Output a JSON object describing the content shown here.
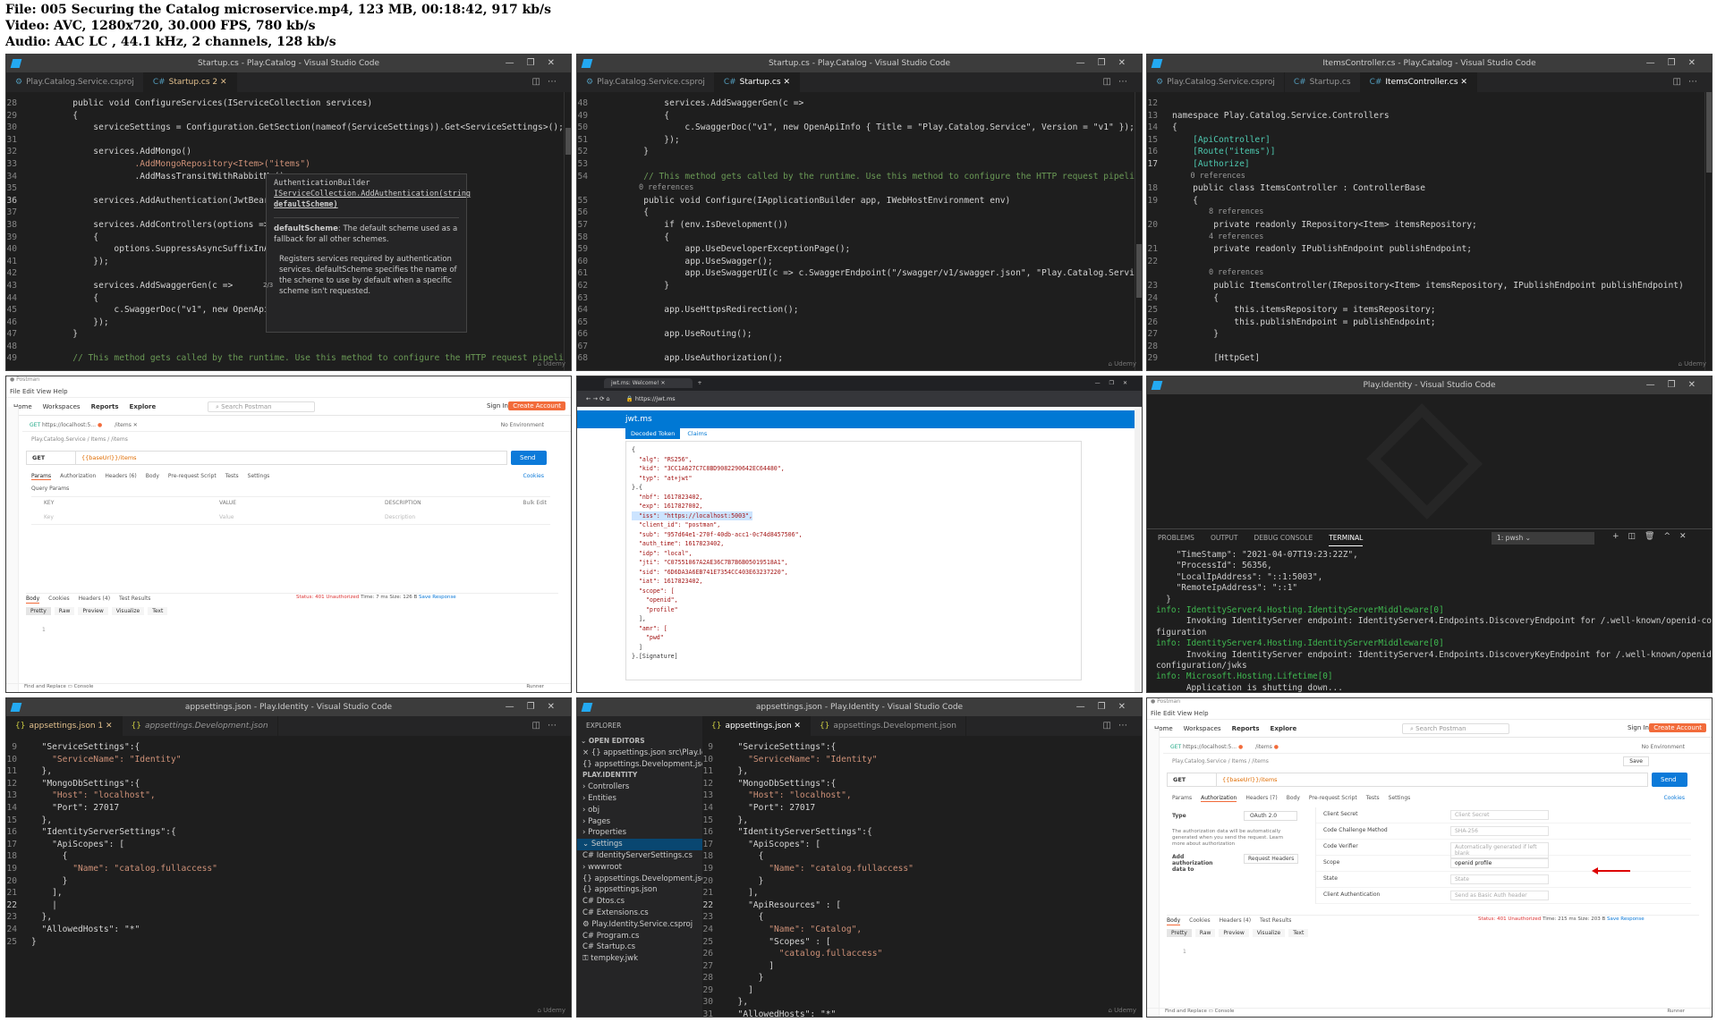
{
  "header": {
    "line1": "File: 005 Securing the Catalog microservice.mp4, 123 MB, 00:18:42, 917 kb/s",
    "line2": "Video: AVC, 1280x720, 30.000 FPS, 780 kb/s",
    "line3": "Audio: AAC LC , 44.1 kHz, 2 channels, 128 kb/s"
  },
  "t1": {
    "title": "Startup.cs - Play.Catalog - Visual Studio Code",
    "tab1": "Play.Catalog.Service.csproj",
    "tab2": "Startup.cs 2",
    "lines": [
      {
        "n": "28",
        "t": "        public void ConfigureServices(IServiceCollection services)"
      },
      {
        "n": "29",
        "t": "        {"
      },
      {
        "n": "30",
        "t": "            serviceSettings = Configuration.GetSection(nameof(ServiceSettings)).Get<ServiceSettings>();"
      },
      {
        "n": "31",
        "t": ""
      },
      {
        "n": "32",
        "t": "            services.AddMongo()"
      },
      {
        "n": "33",
        "t": "                    .AddMongoRepository<Item>(\"items\")"
      },
      {
        "n": "34",
        "t": "                    .AddMassTransitWithRabbitMq();"
      },
      {
        "n": "35",
        "t": ""
      },
      {
        "n": "36",
        "t": "            services.AddAuthentication(JwtBearerDefaults);"
      },
      {
        "n": "37",
        "t": ""
      },
      {
        "n": "38",
        "t": "            services.AddControllers(options =>"
      },
      {
        "n": "39",
        "t": "            {"
      },
      {
        "n": "40",
        "t": "                options.SuppressAsyncSuffixInActionNa"
      },
      {
        "n": "41",
        "t": "            });"
      },
      {
        "n": "42",
        "t": ""
      },
      {
        "n": "43",
        "t": "            services.AddSwaggerGen(c =>"
      },
      {
        "n": "44",
        "t": "            {"
      },
      {
        "n": "45",
        "t": "                c.SwaggerDoc(\"v1\", new OpenApiInfo {"
      },
      {
        "n": "46",
        "t": "            });"
      },
      {
        "n": "47",
        "t": "        }"
      },
      {
        "n": "48",
        "t": ""
      },
      {
        "n": "49",
        "t": "        // This method gets called by the runtime. Use this method to configure the HTTP request pipeline."
      }
    ],
    "hover": {
      "sig1": "AuthenticationBuilder",
      "sig2": "IServiceCollection.AddAuthentication(string",
      "sig3": "defaultScheme)",
      "p1b": "defaultScheme",
      "p1": ": The default scheme used as a fallback for all other schemes.",
      "p2": "Registers services required by authentication services. defaultScheme  specifies the name of the scheme to use by default when a specific scheme isn't requested.",
      "counter": "2/3"
    }
  },
  "t2": {
    "title": "Startup.cs - Play.Catalog - Visual Studio Code",
    "tab1": "Play.Catalog.Service.csproj",
    "tab2": "Startup.cs",
    "lines": [
      {
        "n": "48",
        "t": "            services.AddSwaggerGen(c =>"
      },
      {
        "n": "49",
        "t": "            {"
      },
      {
        "n": "50",
        "t": "                c.SwaggerDoc(\"v1\", new OpenApiInfo { Title = \"Play.Catalog.Service\", Version = \"v1\" });"
      },
      {
        "n": "51",
        "t": "            });"
      },
      {
        "n": "52",
        "t": "        }"
      },
      {
        "n": "53",
        "t": ""
      },
      {
        "n": "54",
        "t": "        // This method gets called by the runtime. Use this method to configure the HTTP request pipeline."
      },
      {
        "n": "",
        "t": "        0 references"
      },
      {
        "n": "55",
        "t": "        public void Configure(IApplicationBuilder app, IWebHostEnvironment env)"
      },
      {
        "n": "56",
        "t": "        {"
      },
      {
        "n": "57",
        "t": "            if (env.IsDevelopment())"
      },
      {
        "n": "58",
        "t": "            {"
      },
      {
        "n": "59",
        "t": "                app.UseDeveloperExceptionPage();"
      },
      {
        "n": "60",
        "t": "                app.UseSwagger();"
      },
      {
        "n": "61",
        "t": "                app.UseSwaggerUI(c => c.SwaggerEndpoint(\"/swagger/v1/swagger.json\", \"Play.Catalog.Service"
      },
      {
        "n": "62",
        "t": "            }"
      },
      {
        "n": "63",
        "t": ""
      },
      {
        "n": "64",
        "t": "            app.UseHttpsRedirection();"
      },
      {
        "n": "65",
        "t": ""
      },
      {
        "n": "66",
        "t": "            app.UseRouting();"
      },
      {
        "n": "67",
        "t": ""
      },
      {
        "n": "68",
        "t": "            app.UseAuthorization();"
      }
    ]
  },
  "t3": {
    "title": "ItemsController.cs - Play.Catalog - Visual Studio Code",
    "tab1": "Play.Catalog.Service.csproj",
    "tab2": "Startup.cs",
    "tab3": "ItemsController.cs",
    "lines": [
      {
        "n": "12",
        "t": ""
      },
      {
        "n": "13",
        "t": "namespace Play.Catalog.Service.Controllers"
      },
      {
        "n": "14",
        "t": "{"
      },
      {
        "n": "15",
        "t": "    [ApiController]"
      },
      {
        "n": "16",
        "t": "    [Route(\"items\")]"
      },
      {
        "n": "17",
        "t": "    [Authorize]"
      },
      {
        "n": "",
        "t": "    0 references"
      },
      {
        "n": "18",
        "t": "    public class ItemsController : ControllerBase"
      },
      {
        "n": "19",
        "t": "    {"
      },
      {
        "n": "",
        "t": "        8 references"
      },
      {
        "n": "20",
        "t": "        private readonly IRepository<Item> itemsRepository;"
      },
      {
        "n": "",
        "t": "        4 references"
      },
      {
        "n": "21",
        "t": "        private readonly IPublishEndpoint publishEndpoint;"
      },
      {
        "n": "22",
        "t": ""
      },
      {
        "n": "",
        "t": "        0 references"
      },
      {
        "n": "23",
        "t": "        public ItemsController(IRepository<Item> itemsRepository, IPublishEndpoint publishEndpoint)"
      },
      {
        "n": "24",
        "t": "        {"
      },
      {
        "n": "25",
        "t": "            this.itemsRepository = itemsRepository;"
      },
      {
        "n": "26",
        "t": "            this.publishEndpoint = publishEndpoint;"
      },
      {
        "n": "27",
        "t": "        }"
      },
      {
        "n": "28",
        "t": ""
      },
      {
        "n": "29",
        "t": "        [HttpGet]"
      }
    ]
  },
  "t4": {
    "menu": "File  Edit  View  Help",
    "nav": [
      "Home",
      "Workspaces",
      "Reports",
      "Explore"
    ],
    "search": "Search Postman",
    "signin": "Sign In",
    "create": "Create Account",
    "tab1": "https://localhost:5...",
    "tab2": "/items",
    "env": "No Environment",
    "crumb": "Play.Catalog.Service / Items / /items",
    "method": "GET",
    "url": "{{baseUrl}}/items",
    "send": "Send",
    "subtabs": [
      "Params",
      "Authorization",
      "Headers (6)",
      "Body",
      "Pre-request Script",
      "Tests",
      "Settings"
    ],
    "cookies": "Cookies",
    "qp": "Query Params",
    "cols": [
      "KEY",
      "VALUE",
      "DESCRIPTION"
    ],
    "bulk": "Bulk Edit",
    "keyph": "Key",
    "valph": "Value",
    "descph": "Description",
    "resptabs": [
      "Body",
      "Cookies",
      "Headers (4)",
      "Test Results"
    ],
    "status": "Status: 401 Unauthorized",
    "time": "Time: 7 ms",
    "size": "Size: 126 B",
    "save": "Save Response",
    "fmt": [
      "Pretty",
      "Raw",
      "Preview",
      "Visualize",
      "Text"
    ],
    "line1": "1",
    "foot1": "Find and Replace",
    "foot2": "Console",
    "runner": "Runner"
  },
  "t5": {
    "tab": "jwt.ms: Welcome!",
    "url": "https://jwt.ms",
    "brand": "jwt.ms",
    "dtab": "Decoded Token",
    "ctab": "Claims",
    "lines": [
      "{",
      "  \"alg\": \"RS256\",",
      "  \"kid\": \"3CC1A627C7C8BD9082290642EC64480\",",
      "  \"typ\": \"at+jwt\"",
      "}.{",
      "  \"nbf\": 1617823402,",
      "  \"exp\": 1617827002,",
      "  \"iss\": \"https://localhost:5003\",",
      "  \"client_id\": \"postman\",",
      "  \"sub\": \"957d64e1-270f-40db-acc1-0c74d8457506\",",
      "  \"auth_time\": 1617823402,",
      "  \"idp\": \"local\",",
      "  \"jti\": \"C07551067A2AE36C7B7B6B05019518A1\",",
      "  \"sid\": \"6D6DA3A6EB741E7354CC403E63237220\",",
      "  \"iat\": 1617823402,",
      "  \"scope\": [",
      "    \"openid\",",
      "    \"profile\"",
      "  ],",
      "  \"amr\": [",
      "    \"pwd\"",
      "  ]",
      "}.[Signature]"
    ]
  },
  "t6": {
    "title": "Play.Identity - Visual Studio Code",
    "ptabs": [
      "PROBLEMS",
      "OUTPUT",
      "DEBUG CONSOLE",
      "TERMINAL"
    ],
    "shell": "1: pwsh",
    "lines": [
      {
        "c": "",
        "t": "    \"TimeStamp\": \"2021-04-07T19:23:22Z\","
      },
      {
        "c": "",
        "t": "    \"ProcessId\": 56356,"
      },
      {
        "c": "",
        "t": "    \"LocalIpAddress\": \"::1:5003\","
      },
      {
        "c": "",
        "t": "    \"RemoteIpAddress\": \"::1\""
      },
      {
        "c": "",
        "t": "  }"
      },
      {
        "c": "inf",
        "t": "info: IdentityServer4.Hosting.IdentityServerMiddleware[0]"
      },
      {
        "c": "",
        "t": "      Invoking IdentityServer endpoint: IdentityServer4.Endpoints.DiscoveryEndpoint for /.well-known/openid-con"
      },
      {
        "c": "",
        "t": "figuration"
      },
      {
        "c": "inf",
        "t": "info: IdentityServer4.Hosting.IdentityServerMiddleware[0]"
      },
      {
        "c": "",
        "t": "      Invoking IdentityServer endpoint: IdentityServer4.Endpoints.DiscoveryKeyEndpoint for /.well-known/openid-"
      },
      {
        "c": "",
        "t": "configuration/jwks"
      },
      {
        "c": "inf",
        "t": "info: Microsoft.Hosting.Lifetime[0]"
      },
      {
        "c": "",
        "t": "      Application is shutting down..."
      },
      {
        "c": "",
        "t": "PS Play.Identity.Service> "
      }
    ]
  },
  "t7": {
    "title": "appsettings.json - Play.Identity - Visual Studio Code",
    "tab1": "appsettings.json 1",
    "tab2": "appsettings.Development.json",
    "lines": [
      {
        "n": "9",
        "t": "  \"ServiceSettings\":{"
      },
      {
        "n": "10",
        "t": "    \"ServiceName\": \"Identity\""
      },
      {
        "n": "11",
        "t": "  },"
      },
      {
        "n": "12",
        "t": "  \"MongoDbSettings\":{"
      },
      {
        "n": "13",
        "t": "    \"Host\": \"localhost\","
      },
      {
        "n": "14",
        "t": "    \"Port\": 27017"
      },
      {
        "n": "15",
        "t": "  },"
      },
      {
        "n": "16",
        "t": "  \"IdentityServerSettings\":{"
      },
      {
        "n": "17",
        "t": "    \"ApiScopes\": ["
      },
      {
        "n": "18",
        "t": "      {"
      },
      {
        "n": "19",
        "t": "        \"Name\": \"catalog.fullaccess\""
      },
      {
        "n": "20",
        "t": "      }"
      },
      {
        "n": "21",
        "t": "    ],"
      },
      {
        "n": "22",
        "t": "    |"
      },
      {
        "n": "23",
        "t": "  },"
      },
      {
        "n": "24",
        "t": "  \"AllowedHosts\": \"*\""
      },
      {
        "n": "25",
        "t": "}"
      }
    ]
  },
  "t8": {
    "title": "appsettings.json - Play.Identity - Visual Studio Code",
    "tab1": "appsettings.json",
    "tab2": "appsettings.Development.json",
    "explorer": "EXPLORER",
    "open": "OPEN EDITORS",
    "proj": "PLAY.IDENTITY",
    "files": [
      {
        "k": "open",
        "t": "× {} appsettings.json  src\\Play.Identit..."
      },
      {
        "k": "open",
        "t": "   {} appsettings.Development.json..."
      },
      {
        "k": "h",
        "t": "PLAY.IDENTITY"
      },
      {
        "k": "f",
        "t": "  › Controllers"
      },
      {
        "k": "f",
        "t": "  › Entities"
      },
      {
        "k": "f",
        "t": "  › obj"
      },
      {
        "k": "f",
        "t": "  › Pages"
      },
      {
        "k": "f",
        "t": "  › Properties"
      },
      {
        "k": "fs",
        "t": "  ⌄ Settings"
      },
      {
        "k": "c",
        "t": "      C# IdentityServerSettings.cs"
      },
      {
        "k": "f",
        "t": "  › wwwroot"
      },
      {
        "k": "j",
        "t": "    {} appsettings.Development.json"
      },
      {
        "k": "j",
        "t": "    {} appsettings.json"
      },
      {
        "k": "c",
        "t": "    C# Dtos.cs"
      },
      {
        "k": "c",
        "t": "    C# Extensions.cs"
      },
      {
        "k": "c",
        "t": "    ⚙ Play.Identity.Service.csproj"
      },
      {
        "k": "c",
        "t": "    C# Program.cs"
      },
      {
        "k": "c",
        "t": "    C# Startup.cs"
      },
      {
        "k": "c",
        "t": "    ⚿ tempkey.jwk"
      }
    ],
    "lines": [
      {
        "n": "9",
        "t": "  \"ServiceSettings\":{"
      },
      {
        "n": "10",
        "t": "    \"ServiceName\": \"Identity\""
      },
      {
        "n": "11",
        "t": "  },"
      },
      {
        "n": "12",
        "t": "  \"MongoDbSettings\":{"
      },
      {
        "n": "13",
        "t": "    \"Host\": \"localhost\","
      },
      {
        "n": "14",
        "t": "    \"Port\": 27017"
      },
      {
        "n": "15",
        "t": "  },"
      },
      {
        "n": "16",
        "t": "  \"IdentityServerSettings\":{"
      },
      {
        "n": "17",
        "t": "    \"ApiScopes\": ["
      },
      {
        "n": "18",
        "t": "      {"
      },
      {
        "n": "19",
        "t": "        \"Name\": \"catalog.fullaccess\""
      },
      {
        "n": "20",
        "t": "      }"
      },
      {
        "n": "21",
        "t": "    ],"
      },
      {
        "n": "22",
        "t": "    \"ApiResources\" : ["
      },
      {
        "n": "23",
        "t": "      {"
      },
      {
        "n": "24",
        "t": "        \"Name\": \"Catalog\","
      },
      {
        "n": "25",
        "t": "        \"Scopes\" : ["
      },
      {
        "n": "26",
        "t": "          \"catalog.fullaccess\""
      },
      {
        "n": "27",
        "t": "        ]"
      },
      {
        "n": "28",
        "t": "      }"
      },
      {
        "n": "29",
        "t": "    ]"
      },
      {
        "n": "30",
        "t": "  },"
      },
      {
        "n": "31",
        "t": "  \"AllowedHosts\": \"*\""
      }
    ]
  },
  "t9": {
    "menu": "File  Edit  View  Help",
    "nav": [
      "Home",
      "Workspaces",
      "Reports",
      "Explore"
    ],
    "search": "Search Postman",
    "signin": "Sign In",
    "create": "Create Account",
    "tab1": "https://localhost:5...",
    "tab2": "/items",
    "env": "No Environment",
    "crumb": "Play.Catalog.Service / Items / /items",
    "save": "Save",
    "method": "GET",
    "url": "{{baseUrl}}/items",
    "send": "Send",
    "subtabs": [
      "Params",
      "Authorization",
      "Headers (7)",
      "Body",
      "Pre-request Script",
      "Tests",
      "Settings"
    ],
    "cookies": "Cookies",
    "typel": "Type",
    "typev": "OAuth 2.0",
    "note": "The authorization data will be automatically generated when you send the request. Learn more about authorization",
    "add": "Add authorization data to",
    "addv": "Request Headers",
    "fields": [
      {
        "l": "Client Secret",
        "v": "Client Secret"
      },
      {
        "l": "Code Challenge Method",
        "v": "SHA-256"
      },
      {
        "l": "Code Verifier",
        "v": "Automatically generated if left blank"
      },
      {
        "l": "Scope",
        "v": "openid profile"
      },
      {
        "l": "State",
        "v": "State"
      },
      {
        "l": "Client Authentication",
        "v": "Send as Basic Auth header"
      }
    ],
    "resptabs": [
      "Body",
      "Cookies",
      "Headers (4)",
      "Test Results"
    ],
    "status": "Status: 401 Unauthorized",
    "time": "Time: 215 ms",
    "size": "Size: 203 B",
    "saveresp": "Save Response",
    "fmt": [
      "Pretty",
      "Raw",
      "Preview",
      "Visualize",
      "Text"
    ],
    "line1": "1",
    "foot1": "Find and Replace",
    "foot2": "Console",
    "runner": "Runner"
  }
}
